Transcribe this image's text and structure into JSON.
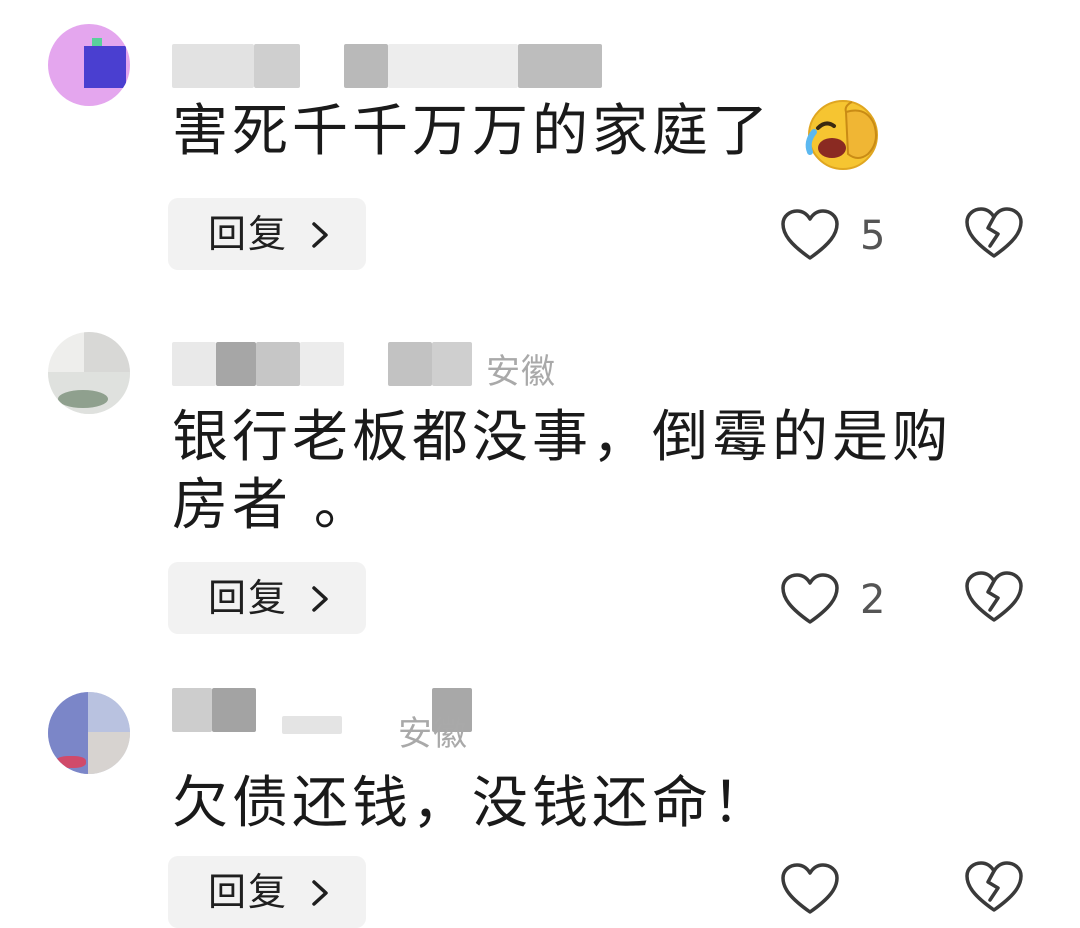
{
  "comments": [
    {
      "location": "",
      "text": "害死千千万万的家庭了",
      "emoji_icon": "laughing-face-palm-emoji",
      "reply_label": "回复",
      "like_count": "5"
    },
    {
      "location": "安徽",
      "text": "银行老板都没事，倒霉的是购房者 。",
      "reply_label": "回复",
      "like_count": "2"
    },
    {
      "location": "安徽",
      "text": "欠债还钱，没钱还命！",
      "reply_label": "回复",
      "like_count": ""
    }
  ],
  "icons": {
    "like": "heart-outline-icon",
    "dislike": "broken-heart-icon",
    "reply_chevron": "chevron-right-icon"
  },
  "colors": {
    "background": "#ffffff",
    "reply_bg": "#f2f2f2",
    "location": "#a9a9a9",
    "icon_stroke": "#3a3a3a"
  }
}
